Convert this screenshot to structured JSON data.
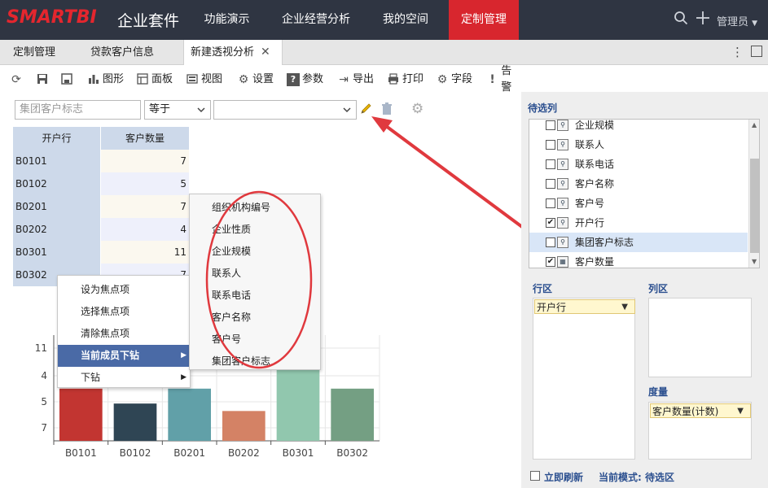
{
  "app": {
    "logo": "SMARTBI",
    "logo_sub": "企业套件",
    "user": "管理员"
  },
  "nav": [
    {
      "label": "功能演示"
    },
    {
      "label": "企业经营分析"
    },
    {
      "label": "我的空间"
    },
    {
      "label": "定制管理"
    }
  ],
  "tabs": [
    {
      "label": "定制管理"
    },
    {
      "label": "贷款客户信息"
    },
    {
      "label": "新建透视分析"
    }
  ],
  "toolbar": {
    "chart": "图形",
    "panel": "面板",
    "view": "视图",
    "settings": "设置",
    "params": "参数",
    "export": "导出",
    "print": "打印",
    "fields": "字段",
    "alert": "告警"
  },
  "filter": {
    "field_placeholder": "集团客户标志",
    "operator": "等于",
    "value": ""
  },
  "table": {
    "headers": [
      "开户行",
      "客户数量"
    ],
    "rows": [
      [
        "B0101",
        "7"
      ],
      [
        "B0102",
        "5"
      ],
      [
        "B0201",
        "7"
      ],
      [
        "B0202",
        "4"
      ],
      [
        "B0301",
        "11"
      ],
      [
        "B0302",
        "7"
      ]
    ]
  },
  "context_menu": [
    {
      "label": "设为焦点项"
    },
    {
      "label": "选择焦点项"
    },
    {
      "label": "清除焦点项"
    },
    {
      "label": "当前成员下钻",
      "submenu": true
    },
    {
      "label": "下钻",
      "submenu": true
    }
  ],
  "submenu": [
    {
      "label": "组织机构编号"
    },
    {
      "label": "企业性质"
    },
    {
      "label": "企业规模"
    },
    {
      "label": "联系人"
    },
    {
      "label": "联系电话"
    },
    {
      "label": "客户名称"
    },
    {
      "label": "客户号"
    },
    {
      "label": "集团客户标志"
    }
  ],
  "chart_data": {
    "type": "bar",
    "categories": [
      "B0101",
      "B0102",
      "B0201",
      "B0202",
      "B0301",
      "B0302"
    ],
    "values": [
      7,
      5,
      7,
      4,
      11,
      7
    ],
    "y_ticks": [
      "11",
      "4",
      "5",
      "7"
    ],
    "colors": [
      "#c23531",
      "#2f4554",
      "#61a0a8",
      "#d48265",
      "#91c7ae",
      "#749f83"
    ],
    "title": "",
    "xlabel": "",
    "ylabel": ""
  },
  "right_panel": {
    "candidates_title": "待选列",
    "fields": [
      {
        "label": "企业规模",
        "checked": false,
        "icon": "dimension-icon"
      },
      {
        "label": "联系人",
        "checked": false,
        "icon": "dimension-icon"
      },
      {
        "label": "联系电话",
        "checked": false,
        "icon": "dimension-icon"
      },
      {
        "label": "客户名称",
        "checked": false,
        "icon": "dimension-icon"
      },
      {
        "label": "客户号",
        "checked": false,
        "icon": "dimension-icon"
      },
      {
        "label": "开户行",
        "checked": true,
        "icon": "dimension-icon"
      },
      {
        "label": "集团客户标志",
        "checked": false,
        "icon": "dimension-icon"
      },
      {
        "label": "客户数量",
        "checked": true,
        "icon": "measure-icon"
      }
    ],
    "row_area_title": "行区",
    "row_area_item": "开户行",
    "col_area_title": "列区",
    "measure_title": "度量",
    "measure_item": "客户数量(计数)",
    "auto_refresh": "立即刷新",
    "mode_label": "当前模式: 待选区"
  },
  "colors": {
    "topbar": "#2f3542",
    "accent": "#d8262e",
    "annotation": "#e0393e"
  }
}
